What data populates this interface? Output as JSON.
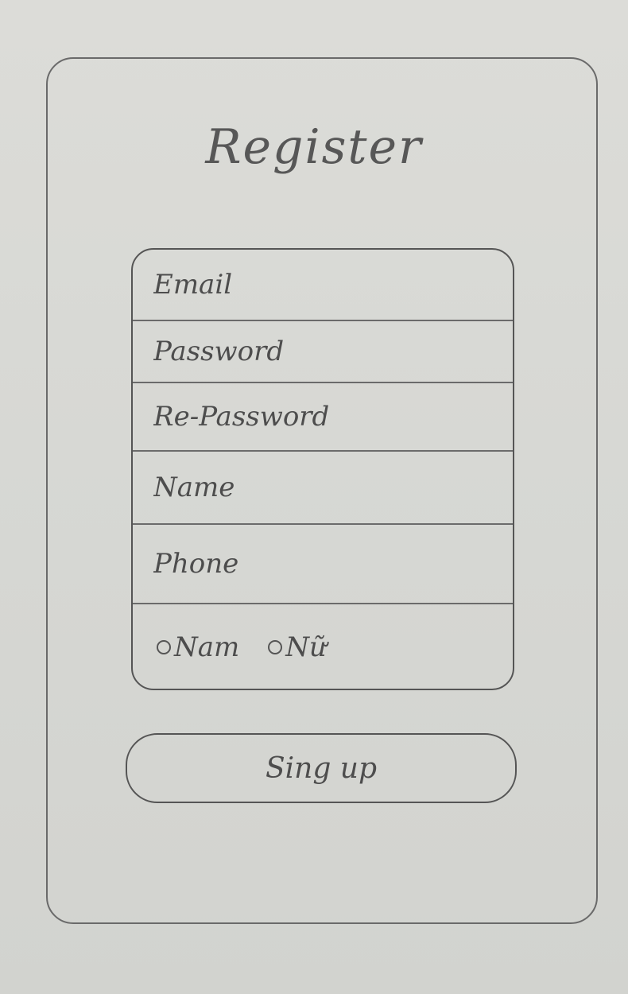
{
  "screen": {
    "title": "Register"
  },
  "form": {
    "email_placeholder": "Email",
    "password_placeholder": "Password",
    "repassword_placeholder": "Re-Password",
    "name_placeholder": "Name",
    "phone_placeholder": "Phone",
    "gender_options": [
      {
        "label": "Nam"
      },
      {
        "label": "Nữ"
      }
    ]
  },
  "actions": {
    "signup_label": "Sing up"
  }
}
